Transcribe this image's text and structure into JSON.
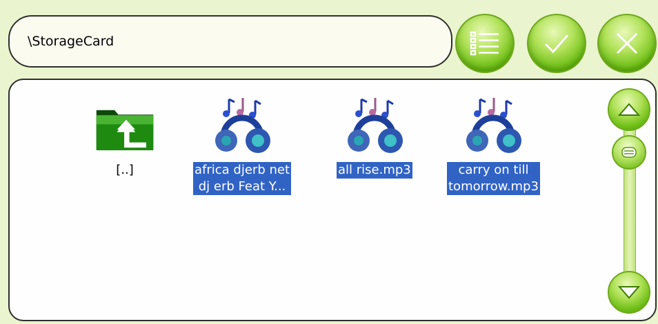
{
  "path_bar": {
    "path": "\\StorageCard"
  },
  "toolbar": {
    "list_view_icon": "list-icon",
    "confirm_icon": "checkmark-icon",
    "close_icon": "close-icon"
  },
  "files": [
    {
      "name": "[..]",
      "type": "parent-folder",
      "icon": "folder-up-icon",
      "selected": false
    },
    {
      "name": "africa djerb net dj erb Feat Y...",
      "line1": "africa djerb net",
      "line2": "dj erb Feat Y...",
      "type": "audio",
      "icon": "headphones-music-icon",
      "selected": true
    },
    {
      "name": "all rise.mp3",
      "line1": "all rise.mp3",
      "type": "audio",
      "icon": "headphones-music-icon",
      "selected": true
    },
    {
      "name": "carry on till tomorrow.mp3",
      "line1": "carry on till",
      "line2": "tomorrow.mp3",
      "type": "audio",
      "icon": "headphones-music-icon",
      "selected": true
    }
  ],
  "scrollbar": {
    "up_icon": "triangle-up-icon",
    "down_icon": "triangle-down-icon",
    "position": 0
  },
  "colors": {
    "accent_green": "#7cc323",
    "selection": "#3163c5",
    "background": "#eaf5cf"
  }
}
